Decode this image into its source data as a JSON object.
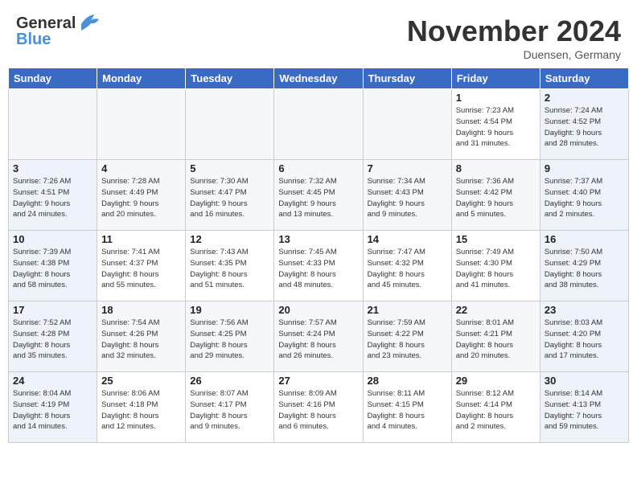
{
  "header": {
    "logo_general": "General",
    "logo_blue": "Blue",
    "month_title": "November 2024",
    "location": "Duensen, Germany"
  },
  "columns": [
    "Sunday",
    "Monday",
    "Tuesday",
    "Wednesday",
    "Thursday",
    "Friday",
    "Saturday"
  ],
  "weeks": [
    [
      {
        "day": "",
        "info": ""
      },
      {
        "day": "",
        "info": ""
      },
      {
        "day": "",
        "info": ""
      },
      {
        "day": "",
        "info": ""
      },
      {
        "day": "",
        "info": ""
      },
      {
        "day": "1",
        "info": "Sunrise: 7:23 AM\nSunset: 4:54 PM\nDaylight: 9 hours\nand 31 minutes."
      },
      {
        "day": "2",
        "info": "Sunrise: 7:24 AM\nSunset: 4:52 PM\nDaylight: 9 hours\nand 28 minutes."
      }
    ],
    [
      {
        "day": "3",
        "info": "Sunrise: 7:26 AM\nSunset: 4:51 PM\nDaylight: 9 hours\nand 24 minutes."
      },
      {
        "day": "4",
        "info": "Sunrise: 7:28 AM\nSunset: 4:49 PM\nDaylight: 9 hours\nand 20 minutes."
      },
      {
        "day": "5",
        "info": "Sunrise: 7:30 AM\nSunset: 4:47 PM\nDaylight: 9 hours\nand 16 minutes."
      },
      {
        "day": "6",
        "info": "Sunrise: 7:32 AM\nSunset: 4:45 PM\nDaylight: 9 hours\nand 13 minutes."
      },
      {
        "day": "7",
        "info": "Sunrise: 7:34 AM\nSunset: 4:43 PM\nDaylight: 9 hours\nand 9 minutes."
      },
      {
        "day": "8",
        "info": "Sunrise: 7:36 AM\nSunset: 4:42 PM\nDaylight: 9 hours\nand 5 minutes."
      },
      {
        "day": "9",
        "info": "Sunrise: 7:37 AM\nSunset: 4:40 PM\nDaylight: 9 hours\nand 2 minutes."
      }
    ],
    [
      {
        "day": "10",
        "info": "Sunrise: 7:39 AM\nSunset: 4:38 PM\nDaylight: 8 hours\nand 58 minutes."
      },
      {
        "day": "11",
        "info": "Sunrise: 7:41 AM\nSunset: 4:37 PM\nDaylight: 8 hours\nand 55 minutes."
      },
      {
        "day": "12",
        "info": "Sunrise: 7:43 AM\nSunset: 4:35 PM\nDaylight: 8 hours\nand 51 minutes."
      },
      {
        "day": "13",
        "info": "Sunrise: 7:45 AM\nSunset: 4:33 PM\nDaylight: 8 hours\nand 48 minutes."
      },
      {
        "day": "14",
        "info": "Sunrise: 7:47 AM\nSunset: 4:32 PM\nDaylight: 8 hours\nand 45 minutes."
      },
      {
        "day": "15",
        "info": "Sunrise: 7:49 AM\nSunset: 4:30 PM\nDaylight: 8 hours\nand 41 minutes."
      },
      {
        "day": "16",
        "info": "Sunrise: 7:50 AM\nSunset: 4:29 PM\nDaylight: 8 hours\nand 38 minutes."
      }
    ],
    [
      {
        "day": "17",
        "info": "Sunrise: 7:52 AM\nSunset: 4:28 PM\nDaylight: 8 hours\nand 35 minutes."
      },
      {
        "day": "18",
        "info": "Sunrise: 7:54 AM\nSunset: 4:26 PM\nDaylight: 8 hours\nand 32 minutes."
      },
      {
        "day": "19",
        "info": "Sunrise: 7:56 AM\nSunset: 4:25 PM\nDaylight: 8 hours\nand 29 minutes."
      },
      {
        "day": "20",
        "info": "Sunrise: 7:57 AM\nSunset: 4:24 PM\nDaylight: 8 hours\nand 26 minutes."
      },
      {
        "day": "21",
        "info": "Sunrise: 7:59 AM\nSunset: 4:22 PM\nDaylight: 8 hours\nand 23 minutes."
      },
      {
        "day": "22",
        "info": "Sunrise: 8:01 AM\nSunset: 4:21 PM\nDaylight: 8 hours\nand 20 minutes."
      },
      {
        "day": "23",
        "info": "Sunrise: 8:03 AM\nSunset: 4:20 PM\nDaylight: 8 hours\nand 17 minutes."
      }
    ],
    [
      {
        "day": "24",
        "info": "Sunrise: 8:04 AM\nSunset: 4:19 PM\nDaylight: 8 hours\nand 14 minutes."
      },
      {
        "day": "25",
        "info": "Sunrise: 8:06 AM\nSunset: 4:18 PM\nDaylight: 8 hours\nand 12 minutes."
      },
      {
        "day": "26",
        "info": "Sunrise: 8:07 AM\nSunset: 4:17 PM\nDaylight: 8 hours\nand 9 minutes."
      },
      {
        "day": "27",
        "info": "Sunrise: 8:09 AM\nSunset: 4:16 PM\nDaylight: 8 hours\nand 6 minutes."
      },
      {
        "day": "28",
        "info": "Sunrise: 8:11 AM\nSunset: 4:15 PM\nDaylight: 8 hours\nand 4 minutes."
      },
      {
        "day": "29",
        "info": "Sunrise: 8:12 AM\nSunset: 4:14 PM\nDaylight: 8 hours\nand 2 minutes."
      },
      {
        "day": "30",
        "info": "Sunrise: 8:14 AM\nSunset: 4:13 PM\nDaylight: 7 hours\nand 59 minutes."
      }
    ]
  ]
}
